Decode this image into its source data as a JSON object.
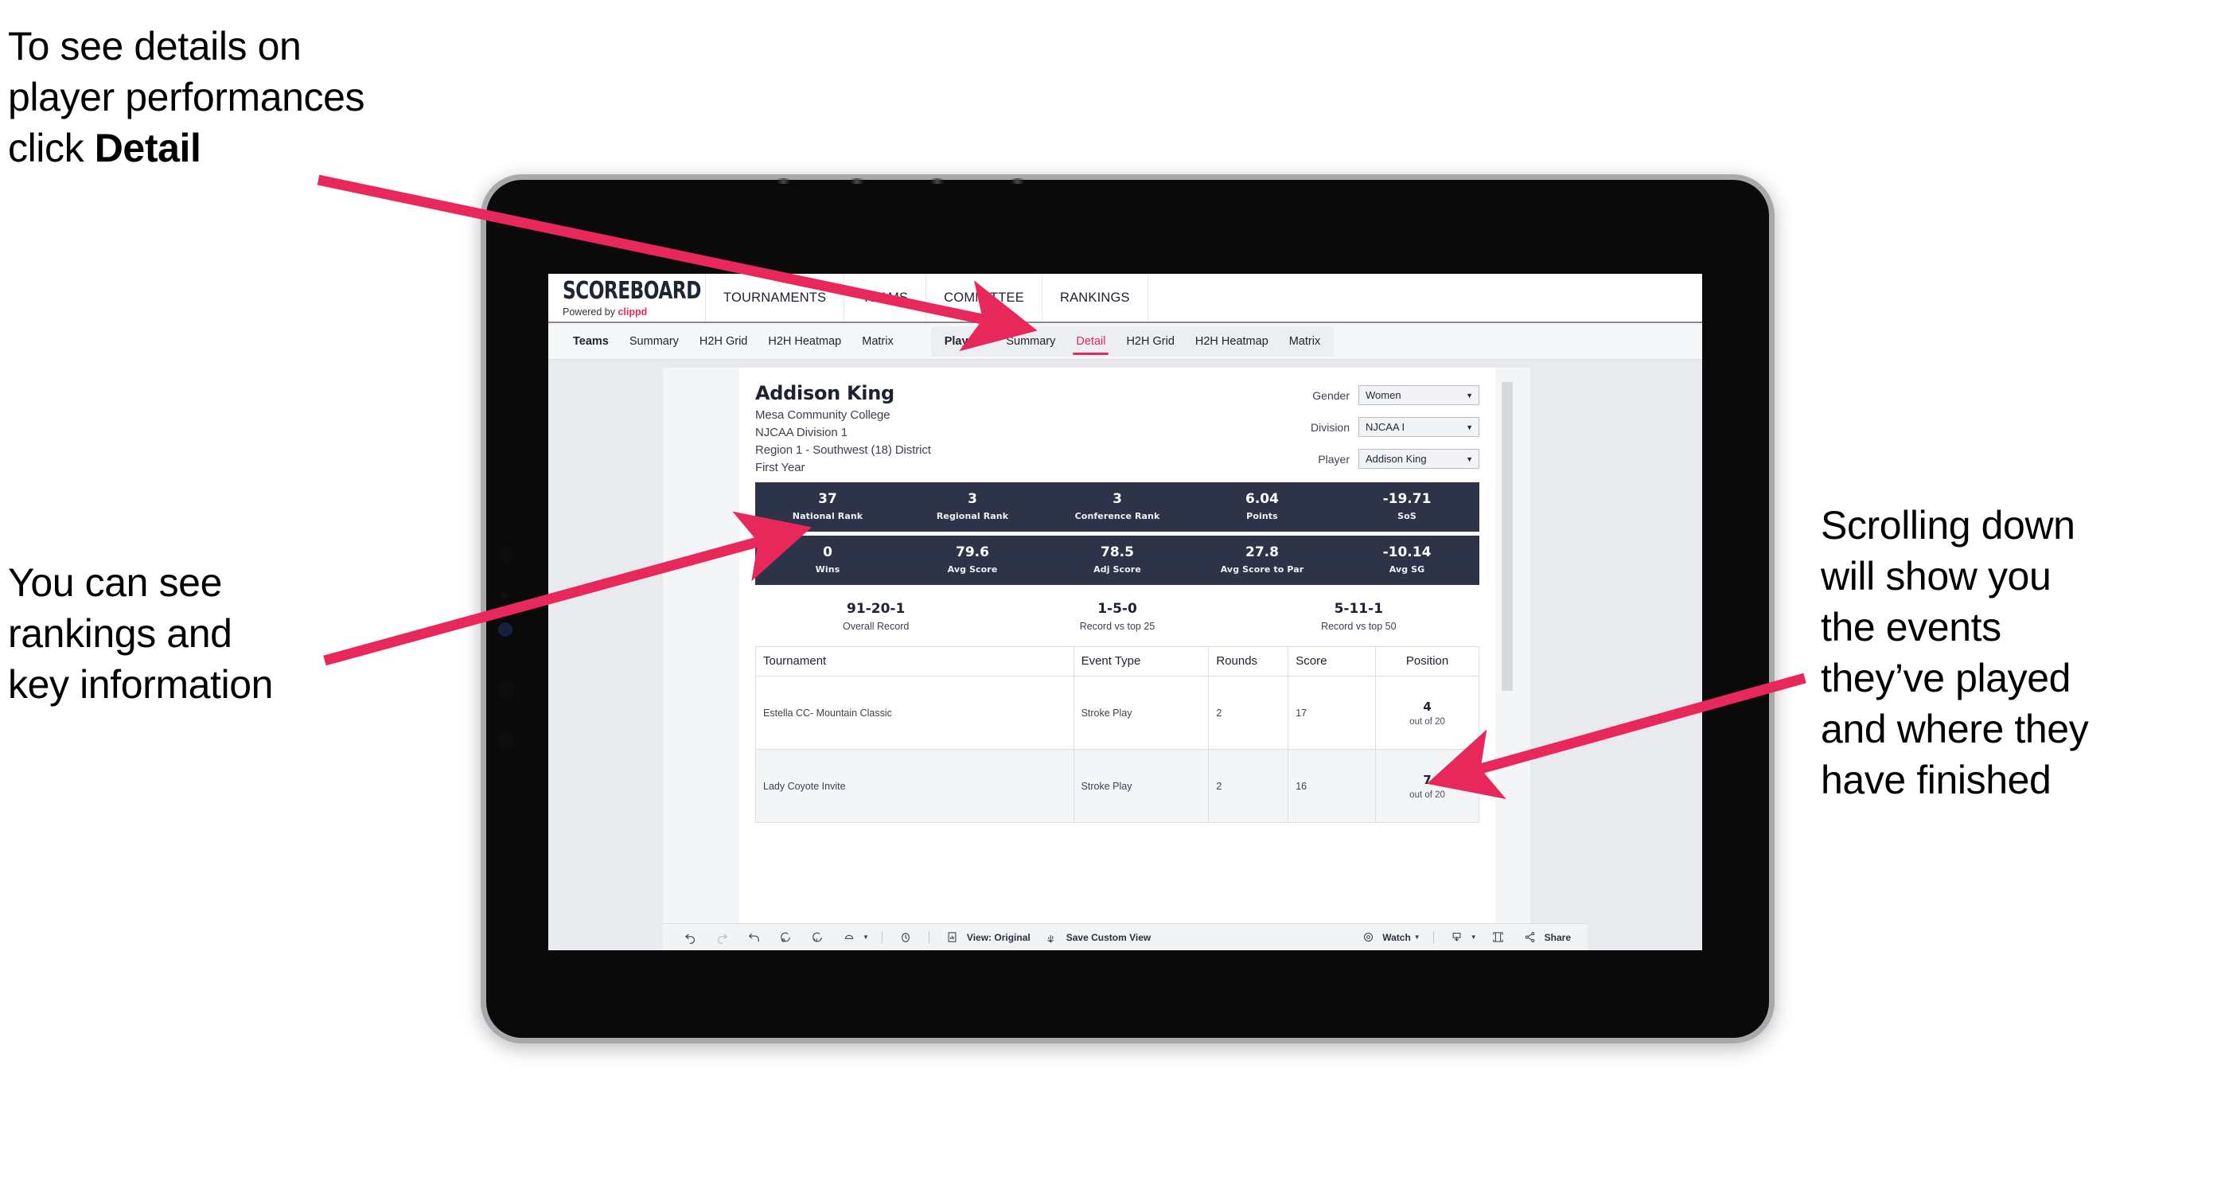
{
  "annotations": {
    "top": "To see details on\nplayer performances\nclick ",
    "top_bold": "Detail",
    "left": "You can see\nrankings and\nkey information",
    "right": "Scrolling down\nwill show you\nthe events\nthey’ve played\nand where they\nhave finished"
  },
  "colors": {
    "accent_pink": "#e8285a",
    "stat_navy": "#2e3448",
    "page_bg": "#e9eaee",
    "tablet_bezel": "#0a0a0a",
    "tablet_frame": "#a8a9ad"
  },
  "brand": {
    "name": "SCOREBOARD",
    "powered_prefix": "Powered by ",
    "powered_brand": "clippd"
  },
  "main_nav": [
    "TOURNAMENTS",
    "TEAMS",
    "COMMITTEE",
    "RANKINGS"
  ],
  "tabs": {
    "group_teams": {
      "label": "Teams",
      "items": [
        "Summary",
        "H2H Grid",
        "H2H Heatmap",
        "Matrix"
      ]
    },
    "group_players": {
      "label": "Players",
      "items": [
        "Summary",
        "Detail",
        "H2H Grid",
        "H2H Heatmap",
        "Matrix"
      ],
      "active": "Detail"
    }
  },
  "player": {
    "name": "Addison King",
    "school": "Mesa Community College",
    "division": "NJCAA Division 1",
    "region": "Region 1 - Southwest (18) District",
    "year": "First Year"
  },
  "filters": [
    {
      "label": "Gender",
      "value": "Women"
    },
    {
      "label": "Division",
      "value": "NJCAA I"
    },
    {
      "label": "Player",
      "value": "Addison King"
    }
  ],
  "stats_row1": [
    {
      "value": "37",
      "label": "National Rank"
    },
    {
      "value": "3",
      "label": "Regional Rank"
    },
    {
      "value": "3",
      "label": "Conference Rank"
    },
    {
      "value": "6.04",
      "label": "Points"
    },
    {
      "value": "-19.71",
      "label": "SoS"
    }
  ],
  "stats_row2": [
    {
      "value": "0",
      "label": "Wins"
    },
    {
      "value": "79.6",
      "label": "Avg Score"
    },
    {
      "value": "78.5",
      "label": "Adj Score"
    },
    {
      "value": "27.8",
      "label": "Avg Score to Par"
    },
    {
      "value": "-10.14",
      "label": "Avg SG"
    }
  ],
  "records": [
    {
      "value": "91-20-1",
      "label": "Overall Record"
    },
    {
      "value": "1-5-0",
      "label": "Record vs top 25"
    },
    {
      "value": "5-11-1",
      "label": "Record vs top 50"
    }
  ],
  "table": {
    "headers": [
      "Tournament",
      "Event Type",
      "Rounds",
      "Score",
      "Position"
    ],
    "rows": [
      {
        "tournament": "Estella CC- Mountain Classic",
        "event_type": "Stroke Play",
        "rounds": "2",
        "score": "17",
        "position": "4",
        "position_of": "out of 20"
      },
      {
        "tournament": "Lady Coyote Invite",
        "event_type": "Stroke Play",
        "rounds": "2",
        "score": "16",
        "position": "7",
        "position_of": "out of 20"
      }
    ]
  },
  "toolbar": {
    "view_label": "View: Original",
    "save_label": "Save Custom View",
    "watch_label": "Watch",
    "share_label": "Share"
  }
}
